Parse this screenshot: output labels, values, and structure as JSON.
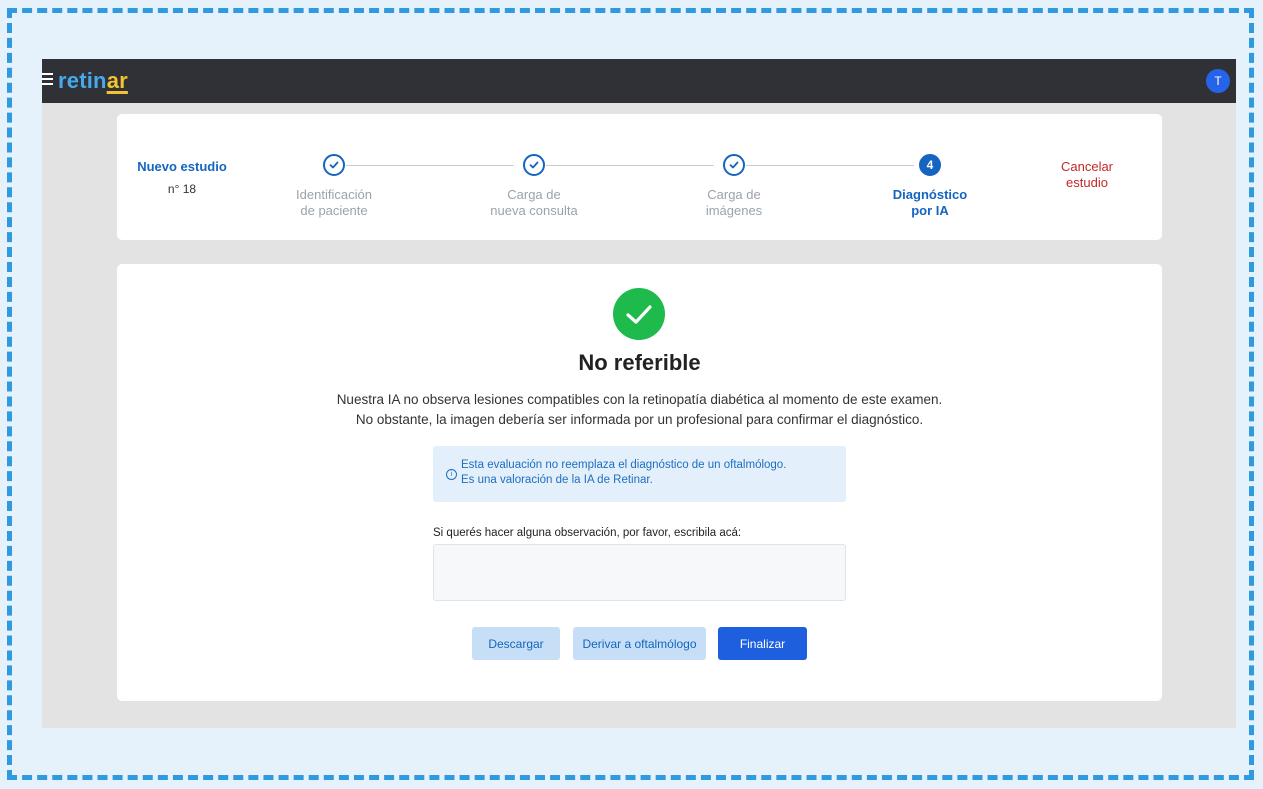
{
  "app": {
    "logo_main": "retin",
    "logo_accent": "ar",
    "user_initial": "T",
    "colors": {
      "brand": "#46a9ee",
      "accent": "#f2c230",
      "topbar": "#2f3137",
      "success": "#1fba4c",
      "danger": "#c62828"
    }
  },
  "study": {
    "title": "Nuevo estudio",
    "number": "n° 18",
    "cancel": "Cancelar\nestudio"
  },
  "steps": [
    {
      "label": "Identificación\nde paciente",
      "status": "done"
    },
    {
      "label": "Carga de\nnueva consulta",
      "status": "done"
    },
    {
      "label": "Carga de\nimágenes",
      "status": "done"
    },
    {
      "label": "Diagnóstico\npor IA",
      "status": "active",
      "number": "4"
    }
  ],
  "result": {
    "title": "No referible",
    "description_line1": "Nuestra IA no observa lesiones compatibles con la retinopatía diabética al momento de este examen.",
    "description_line2": "No obstante, la imagen debería ser informada por un profesional para confirmar el diagnóstico.",
    "notice_icon": "info-icon",
    "notice_line1": "Esta evaluación no reemplaza el diagnóstico de un oftalmólogo.",
    "notice_line2": "Es una valoración de la IA de Retinar."
  },
  "observation": {
    "label": "Si querés hacer alguna observación, por favor, escribila acá:",
    "value": "",
    "placeholder": ""
  },
  "actions": {
    "download": "Descargar",
    "refer": "Derivar a oftalmólogo",
    "finish": "Finalizar"
  }
}
